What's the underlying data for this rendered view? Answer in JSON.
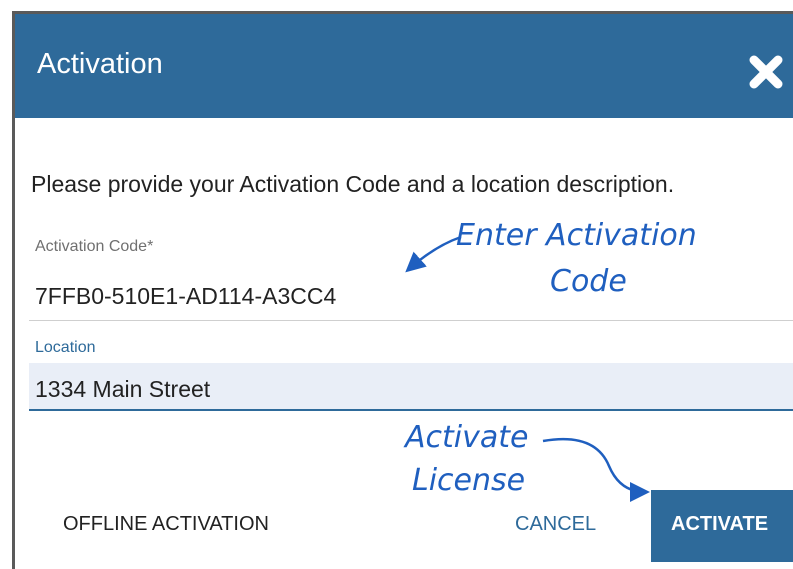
{
  "dialog": {
    "title": "Activation",
    "close_icon": "close-icon",
    "header_color": "#2e6a9a"
  },
  "instructions": "Please provide your Activation Code and a location description.",
  "activation_code": {
    "label": "Activation Code*",
    "value": "7FFB0-510E1-AD114-A3CC4"
  },
  "location": {
    "label": "Location",
    "value": "1334 Main Street"
  },
  "annotations": {
    "enter_code_line1": "Enter Activation",
    "enter_code_line2": "Code",
    "activate_line1": "Activate",
    "activate_line2": "License",
    "color": "#1f5fbf"
  },
  "buttons": {
    "offline": "OFFLINE ACTIVATION",
    "cancel": "CANCEL",
    "activate": "ACTIVATE"
  }
}
